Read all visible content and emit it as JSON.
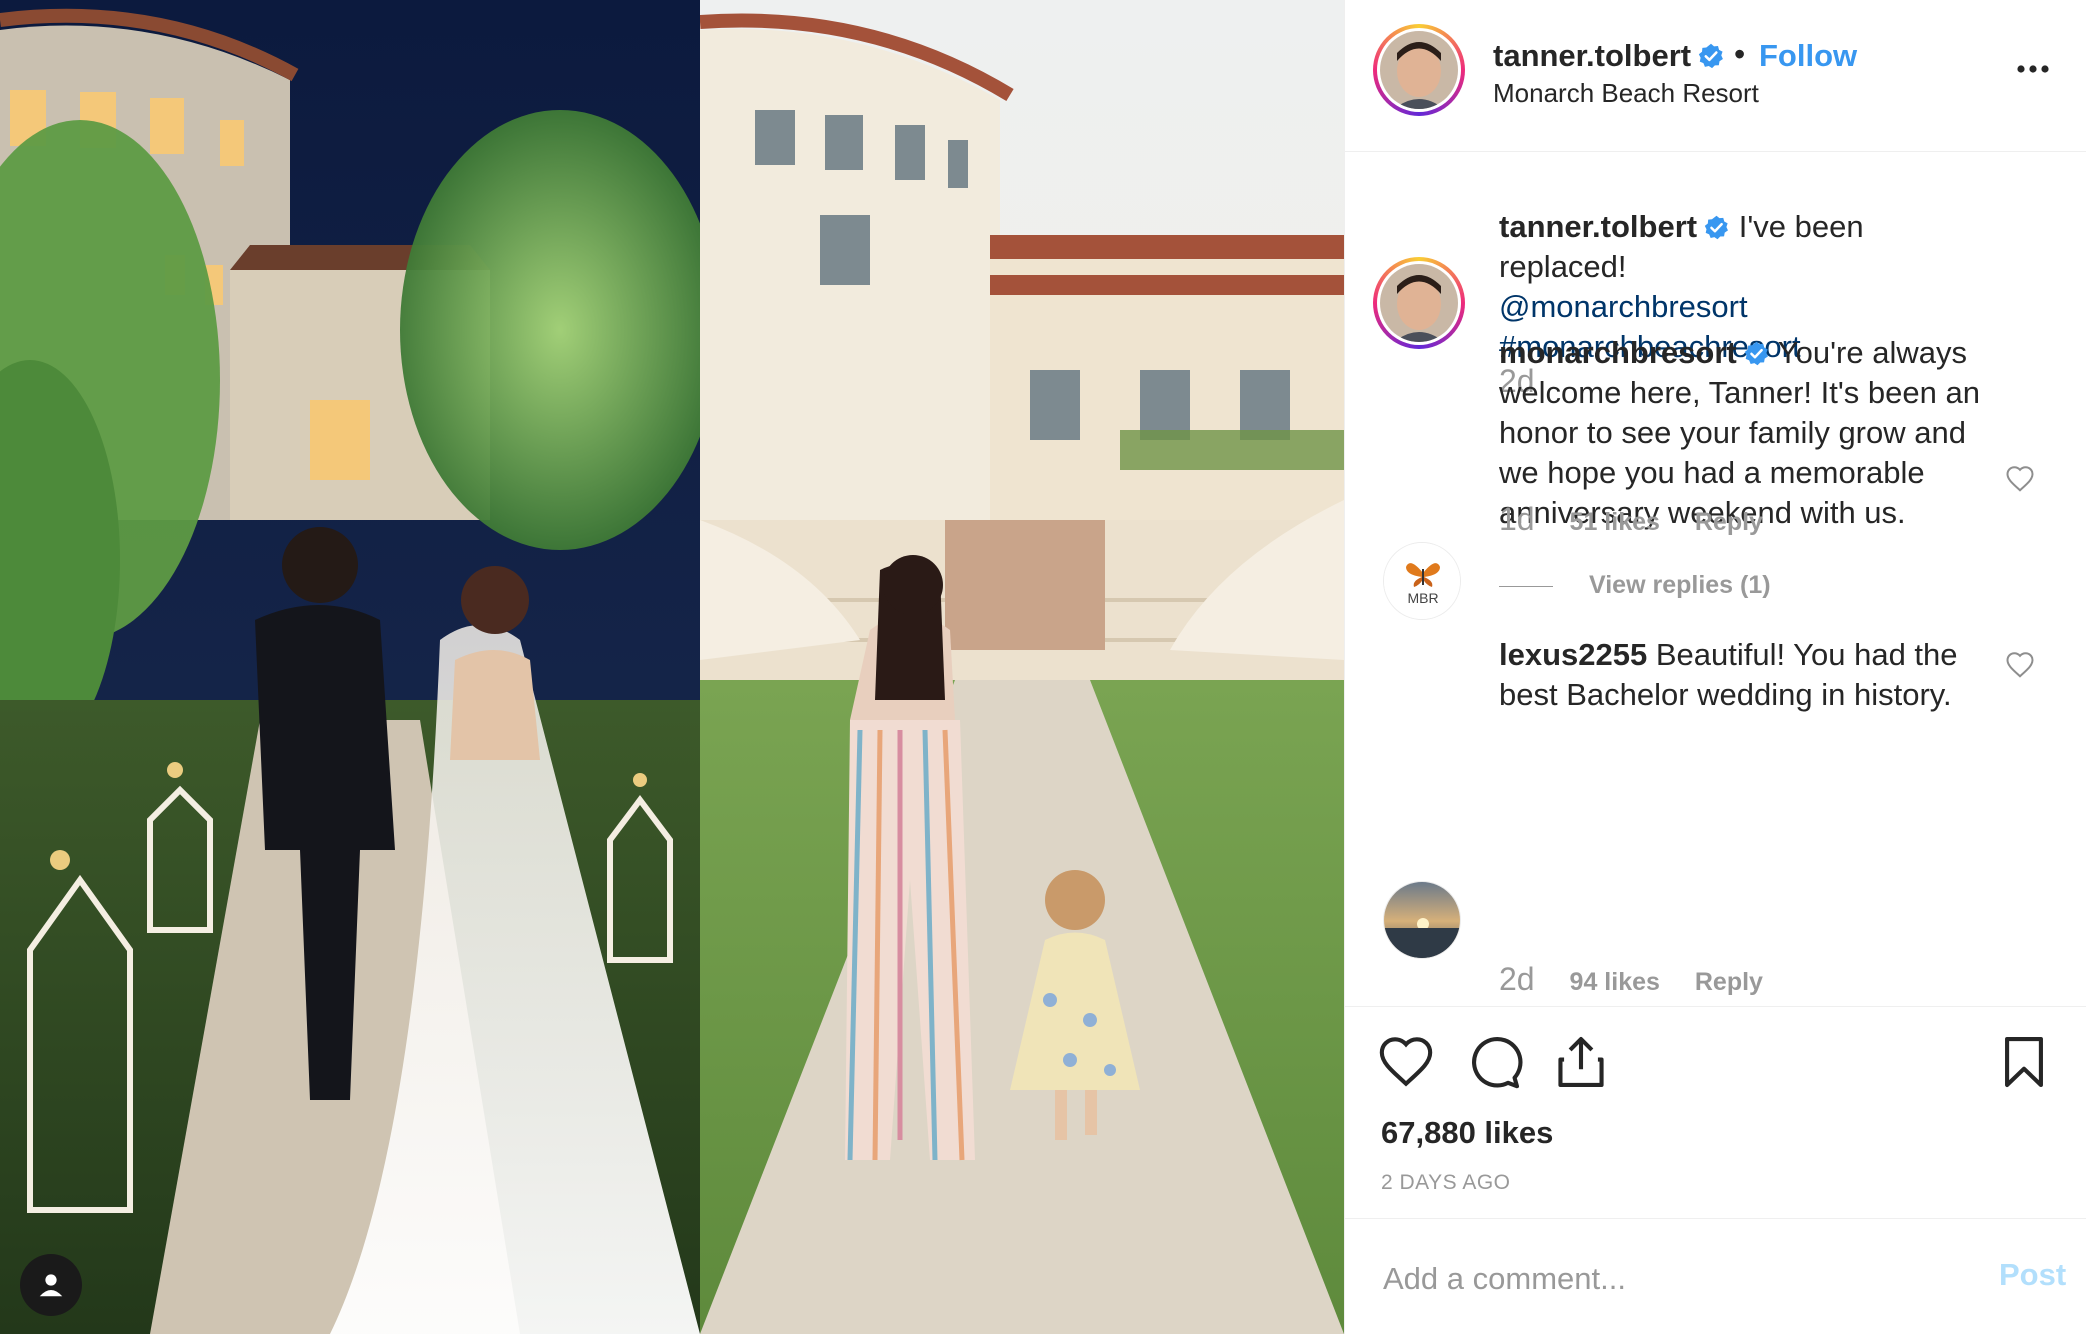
{
  "post": {
    "author": "tanner.tolbert",
    "follow_label": "Follow",
    "location": "Monarch Beach Resort",
    "separator": "•"
  },
  "caption": {
    "username": "tanner.tolbert",
    "text": "I've been replaced!",
    "mention": "@monarchbresort",
    "hashtag": "#monarchbeachresort",
    "time": "2d"
  },
  "comments": [
    {
      "username": "monarchbresort",
      "avatar_text": "MBR",
      "text": "You're always welcome here, Tanner! It's been an honor to see your family grow and we hope you had a memorable anniversary weekend with us.",
      "time": "1d",
      "likes": "51 likes",
      "reply_label": "Reply",
      "view_replies": "View replies (1)"
    },
    {
      "username": "lexus2255",
      "text": "Beautiful! You had the best Bachelor wedding in history.",
      "time": "2d",
      "likes": "94 likes",
      "reply_label": "Reply"
    }
  ],
  "engagement": {
    "likes": "67,880 likes",
    "posted": "2 DAYS AGO"
  },
  "comment_form": {
    "placeholder": "Add a comment...",
    "post_label": "Post"
  },
  "colors": {
    "link_blue": "#3897f0",
    "verified_blue": "#3897f0",
    "hashtag_blue": "#003569",
    "muted_gray": "#999999"
  },
  "icons": [
    "verified-badge-icon",
    "more-options-icon",
    "heart-icon",
    "comment-icon",
    "share-icon",
    "bookmark-icon",
    "user-tag-icon"
  ]
}
